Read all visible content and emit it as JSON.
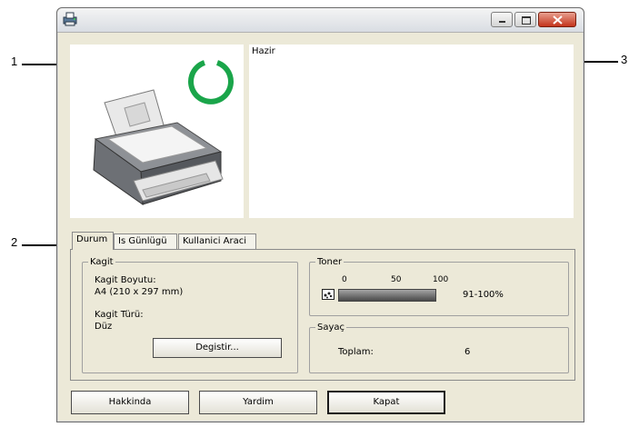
{
  "callouts": {
    "one": "1",
    "two": "2",
    "three": "3"
  },
  "status": {
    "message": "Hazir"
  },
  "tabs": [
    {
      "label": "Durum"
    },
    {
      "label": "Is Günlügü"
    },
    {
      "label": "Kullanici Araci"
    }
  ],
  "paper": {
    "group_title": "Kagit",
    "size_label": "Kagit Boyutu:",
    "size_value": "A4 (210 x 297 mm)",
    "type_label": "Kagit Türü:",
    "type_value": "Düz",
    "change_button": "Degistir..."
  },
  "toner": {
    "group_title": "Toner",
    "tick_0": "0",
    "tick_50": "50",
    "tick_100": "100",
    "level_text": "91-100%",
    "level_fraction": 1.0
  },
  "counter": {
    "group_title": "Sayaç",
    "total_label": "Toplam:",
    "total_value": "6"
  },
  "buttons": {
    "about": "Hakkinda",
    "help": "Yardim",
    "close": "Kapat"
  },
  "colors": {
    "ready_ring": "#1aa54a",
    "close_button": "#c4331b"
  },
  "icons": {
    "app": "printer-app-icon",
    "minimize": "minimize-icon",
    "maximize": "maximize-icon",
    "close": "close-icon",
    "toner": "toner-cartridge-icon",
    "ready": "ready-ring-icon"
  }
}
